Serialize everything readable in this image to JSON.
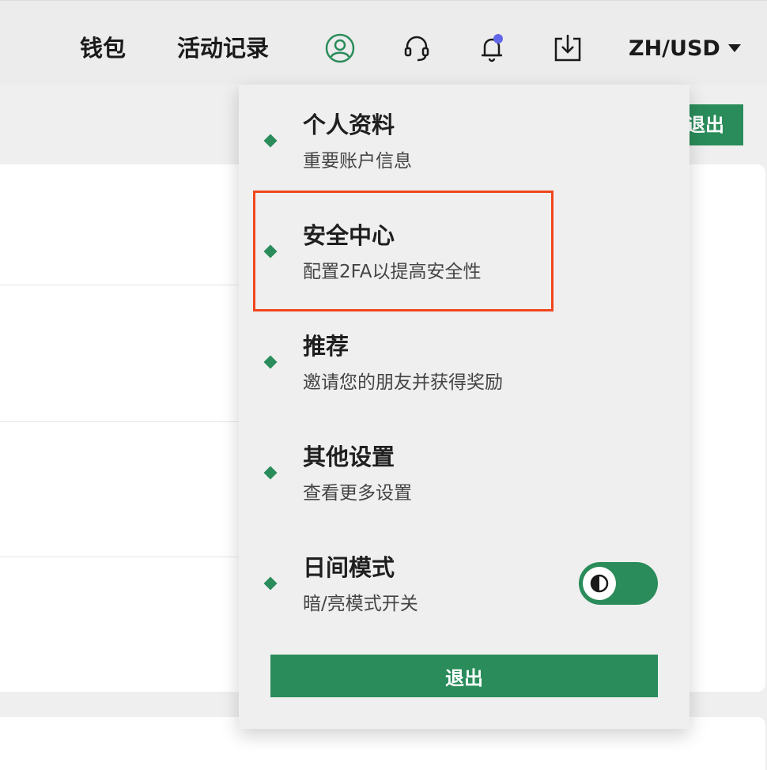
{
  "topbar": {
    "wallet_label": "钱包",
    "activity_label": "活动记录",
    "icons": [
      "user-icon",
      "headset-icon",
      "bell-icon",
      "download-icon"
    ],
    "notification_dot_color": "#6166e8",
    "language_label": "ZH/USD"
  },
  "page": {
    "logout_label": "退出"
  },
  "menu": {
    "items": [
      {
        "title": "个人资料",
        "subtitle": "重要账户信息"
      },
      {
        "title": "安全中心",
        "subtitle": "配置2FA以提高安全性"
      },
      {
        "title": "推荐",
        "subtitle": "邀请您的朋友并获得奖励"
      },
      {
        "title": "其他设置",
        "subtitle": "查看更多设置"
      },
      {
        "title": "日间模式",
        "subtitle": "暗/亮模式开关"
      }
    ],
    "highlighted_item": "安全中心",
    "logout_label": "退出"
  },
  "colors": {
    "accent": "#2a8c5a",
    "highlight": "#f0461e"
  }
}
